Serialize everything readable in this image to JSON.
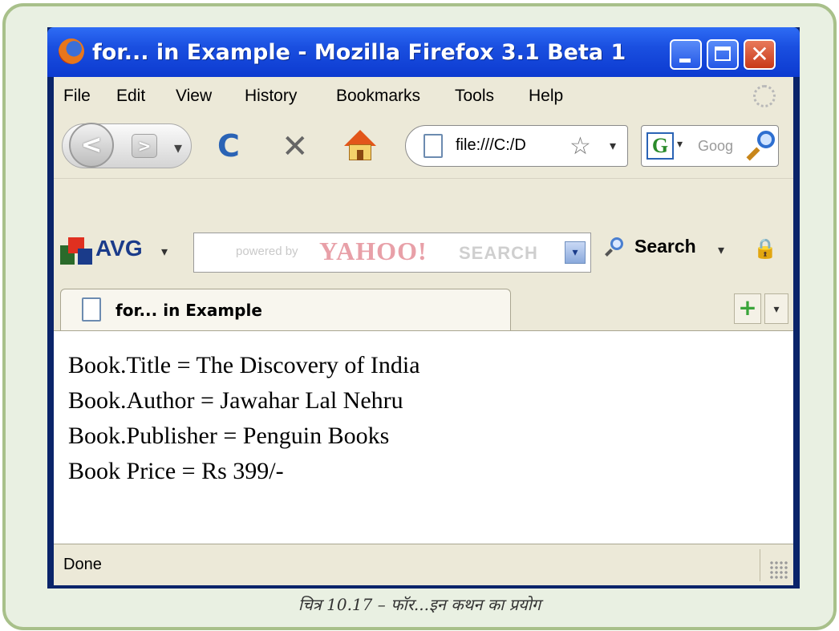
{
  "window": {
    "title": "for... in Example - Mozilla Firefox 3.1 Beta 1",
    "controls": {
      "minimize": "_",
      "maximize": "□",
      "close": "✕"
    }
  },
  "menu": [
    "File",
    "Edit",
    "View",
    "History",
    "Bookmarks",
    "Tools",
    "Help"
  ],
  "nav": {
    "back": "<",
    "forward": ">",
    "dropdown": "▾",
    "reload": "C",
    "stop": "✕",
    "url": "file:///C:/D",
    "star": "☆",
    "url_dropdown": "▾",
    "search_engine": "G",
    "search_engine_dropdown": "▾",
    "search_placeholder": "Goog"
  },
  "avg_toolbar": {
    "brand": "AVG",
    "brand_dropdown": "▾",
    "powered_by": "powered by",
    "yahoo": "YAHOO!",
    "search_word": "SEARCH",
    "search_dropdown": "▾",
    "search_button": "Search",
    "search_button_dropdown": "▾"
  },
  "tab": {
    "label": "for... in Example",
    "new_tab": "+",
    "tab_list": "▾"
  },
  "content": {
    "lines": [
      "Book.Title = The Discovery of India",
      "Book.Author = Jawahar Lal Nehru",
      "Book.Publisher = Penguin Books",
      "Book Price = Rs 399/-"
    ]
  },
  "status": {
    "text": "Done"
  },
  "caption": "चित्र 10.17 – फॉर...इन कथन का प्रयोग",
  "colors": {
    "titlebar": "#1a4fe0",
    "frame_border": "#a8c08a",
    "chrome": "#ece9d8",
    "close_button": "#c8391a"
  }
}
